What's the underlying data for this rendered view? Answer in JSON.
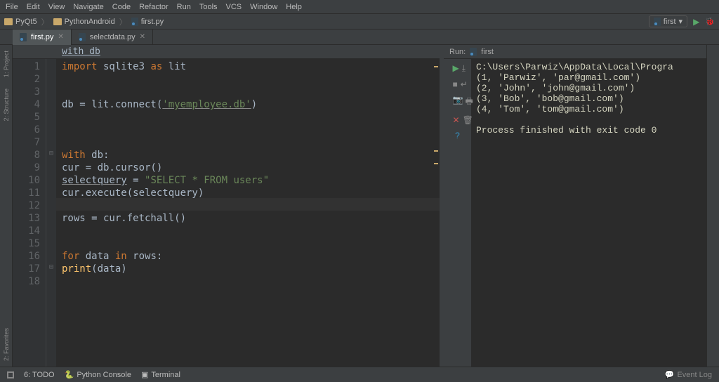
{
  "menubar": [
    "File",
    "Edit",
    "View",
    "Navigate",
    "Code",
    "Refactor",
    "Run",
    "Tools",
    "VCS",
    "Window",
    "Help"
  ],
  "breadcrumbs": {
    "proj": "PyQt5",
    "mid": "PythonAndroid",
    "file": "first.py"
  },
  "run_config": {
    "name": "first"
  },
  "tabs": [
    {
      "label": "first.py",
      "active": true
    },
    {
      "label": "selectdata.py",
      "active": false
    }
  ],
  "context_crumb": "with db",
  "code_lines": 18,
  "code": {
    "l1_kw": "import",
    "l1_mod": "sqlite3",
    "l1_as": " as ",
    "l1_alias": "lit",
    "l4_a": "db = lit.connect(",
    "l4_str": "'myemployee.db'",
    "l4_b": ")",
    "l8_kw": "with ",
    "l8_v": "db:",
    "l9": "    cur = db.cursor()",
    "l10_a": "    ",
    "l10_var": "selectquery",
    "l10_eq": " = ",
    "l10_str": "\"SELECT * FROM users\"",
    "l11": "    cur.execute(selectquery)",
    "l13": "    rows = cur.fetchall()",
    "l16_kw": "    for ",
    "l16_a": "data ",
    "l16_in": "in ",
    "l16_b": "rows:",
    "l17_a": "        ",
    "l17_fn": "print",
    "l17_b": "(data)"
  },
  "run_header": {
    "label": "Run:",
    "target": "first"
  },
  "console_lines": [
    "C:\\Users\\Parwiz\\AppData\\Local\\Progra",
    "(1, 'Parwiz', 'par@gmail.com')",
    "(2, 'John', 'john@gmail.com')",
    "(3, 'Bob', 'bob@gmail.com')",
    "(4, 'Tom', 'tom@gmail.com')",
    "",
    "Process finished with exit code 0"
  ],
  "sidebar_left": [
    "1: Project",
    "2: Structure",
    "2: Favorites"
  ],
  "bottombar": {
    "todo": "6: TODO",
    "pyconsole": "Python Console",
    "terminal": "Terminal",
    "eventlog": "Event Log"
  }
}
